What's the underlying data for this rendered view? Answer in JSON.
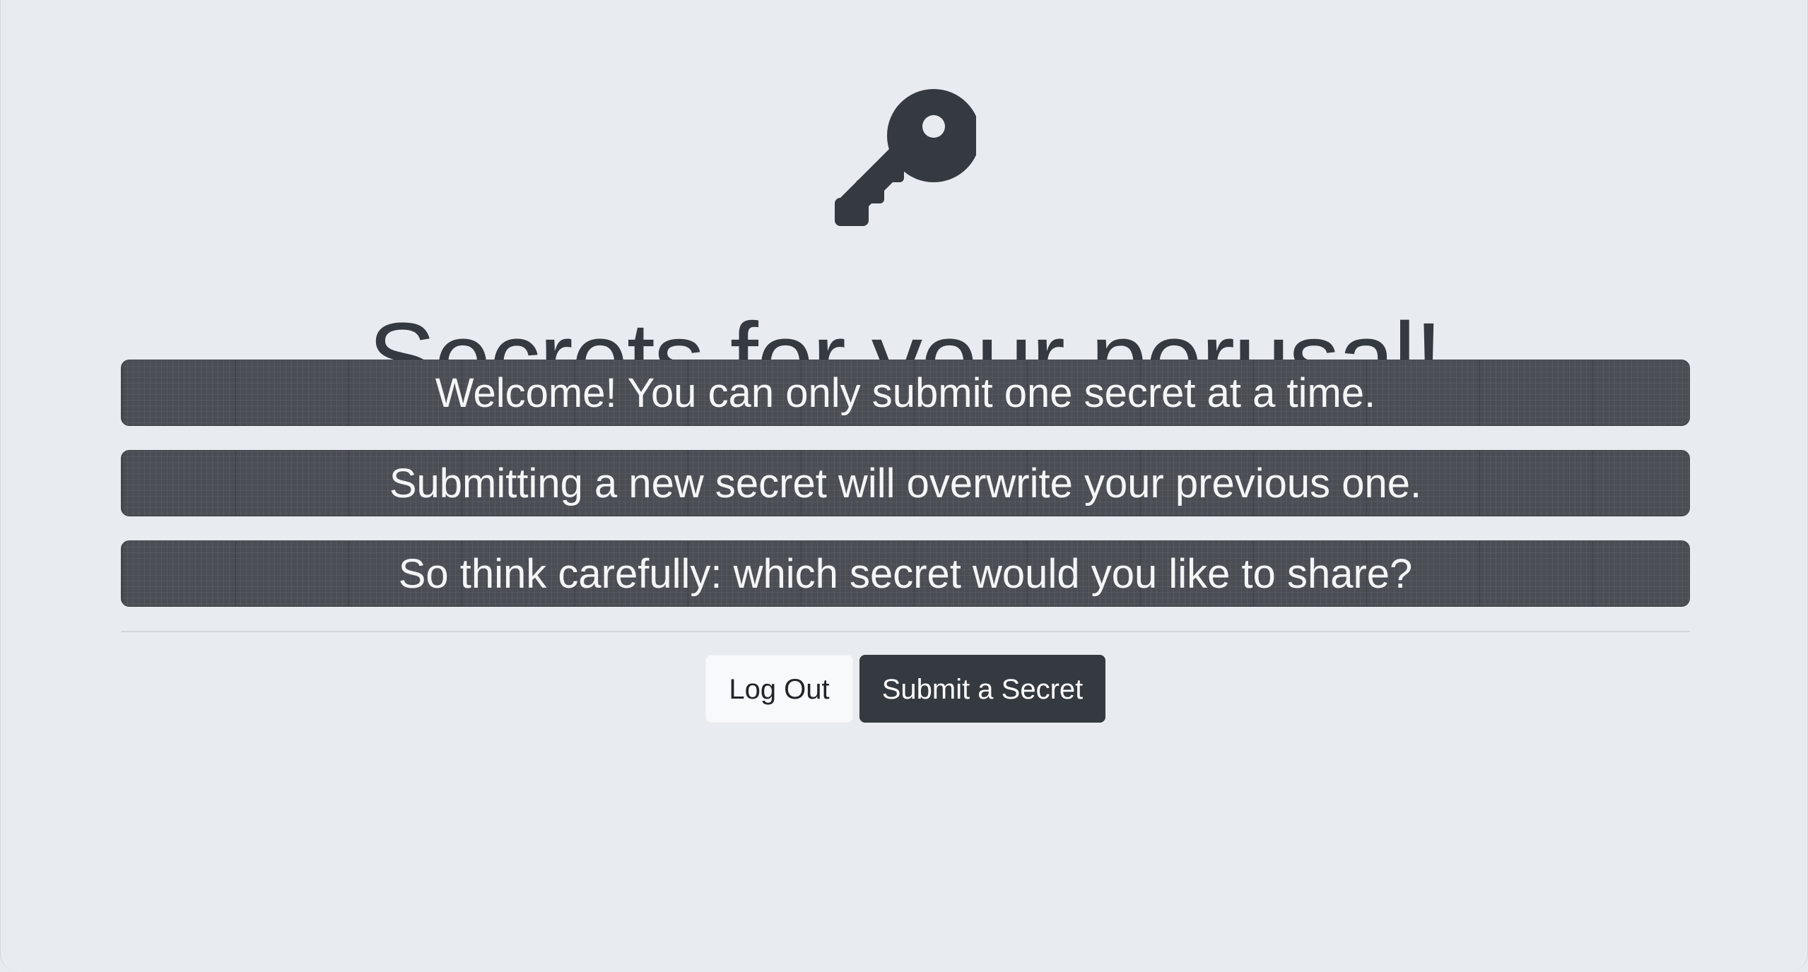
{
  "header": {
    "icon": "key-icon",
    "title": "Secrets for your perusal!"
  },
  "secrets": [
    "Welcome! You can only submit one secret at a time.",
    "Submitting a new secret will overwrite your previous one.",
    "So think carefully: which secret would you like to share?"
  ],
  "actions": {
    "logout_label": "Log Out",
    "submit_label": "Submit a Secret"
  },
  "colors": {
    "background": "#e8ebef",
    "primary_dark": "#343a40",
    "card_background": "#4a4e54",
    "light_button": "#f8f9fa"
  }
}
